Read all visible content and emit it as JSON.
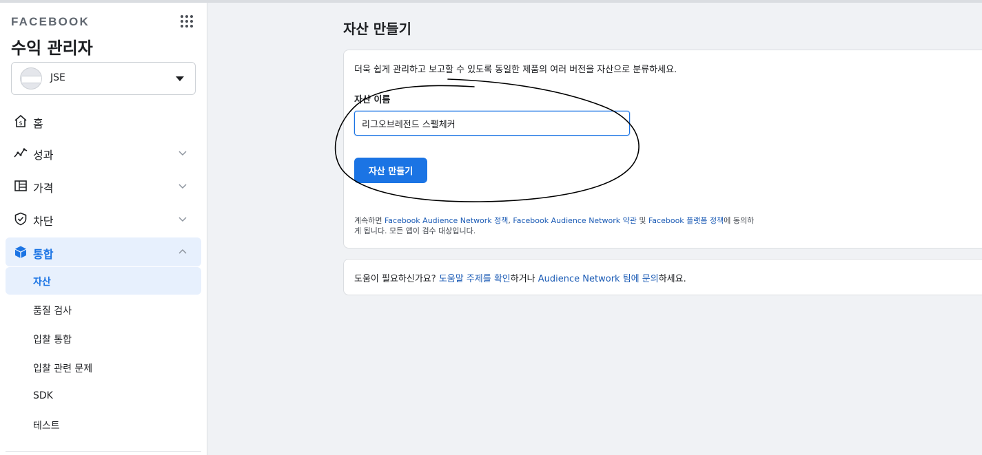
{
  "sidebar": {
    "brand": "FACEBOOK",
    "app_title": "수익 관리자",
    "account": {
      "name": "JSE"
    },
    "nav": [
      {
        "label": "홈",
        "icon": "home-dollar-icon"
      },
      {
        "label": "성과",
        "icon": "trend-line-icon"
      },
      {
        "label": "가격",
        "icon": "stack-icon"
      },
      {
        "label": "차단",
        "icon": "shield-check-icon"
      },
      {
        "label": "통합",
        "icon": "cube-icon",
        "expanded": true
      }
    ],
    "sub_items": [
      {
        "label": "자산",
        "active": true
      },
      {
        "label": "품질 검사"
      },
      {
        "label": "입찰 통합"
      },
      {
        "label": "입찰 관련 문제"
      },
      {
        "label": "SDK"
      },
      {
        "label": "테스트"
      }
    ]
  },
  "main": {
    "title": "자산 만들기",
    "description": "더욱 쉽게 관리하고 보고할 수 있도록 동일한 제품의 여러 버전을 자산으로 분류하세요.",
    "field_label": "자산 이름",
    "name_value": "리그오브레전드 스펠체커",
    "create_button": "자산 만들기",
    "legal": {
      "prefix": "계속하면 ",
      "link1": "Facebook Audience Network 정책",
      "sep1": ", ",
      "link2": "Facebook Audience Network 약관",
      "sep2": " 및 ",
      "link3": "Facebook 플랫폼 정책",
      "suffix": "에 동의하게 됩니다. 모든 앱이 검수 대상입니다."
    },
    "help": {
      "prefix": "도움이 필요하신가요? ",
      "link1": "도움말 주제를 확인",
      "middle": "하거나 ",
      "link2": "Audience Network 팀에 문의",
      "suffix": "하세요."
    }
  },
  "colors": {
    "accent": "#1b74e4",
    "active_bg": "#e7f0fd",
    "page_bg": "#f0f2f5"
  }
}
